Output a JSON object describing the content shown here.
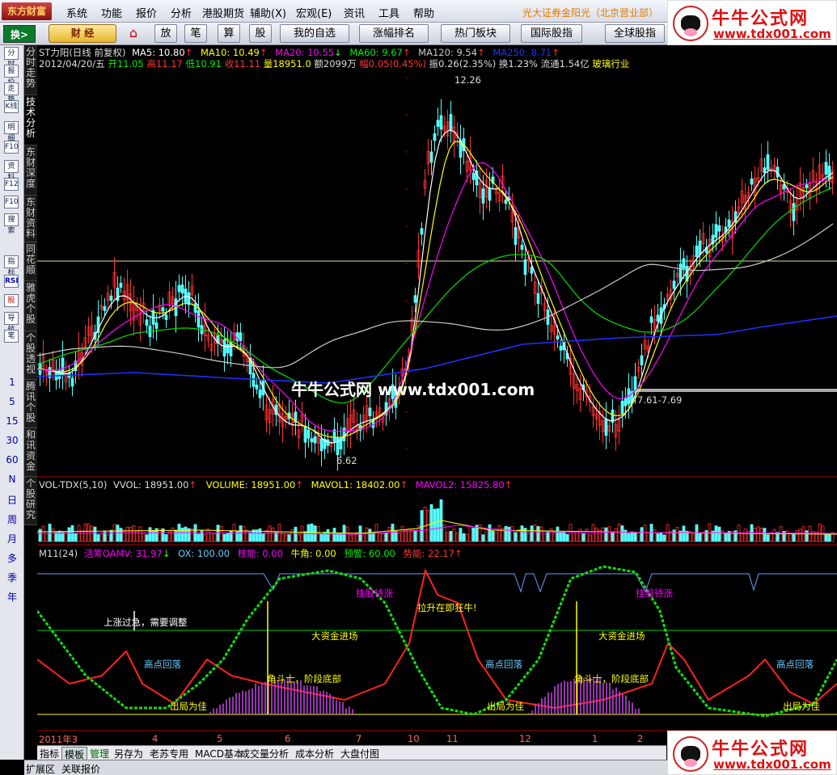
{
  "menubar": {
    "logo": "东方财富",
    "items": [
      "系统",
      "功能",
      "报价",
      "分析",
      "港股期货",
      "辅助(X)",
      "宏观(E)",
      "资讯",
      "工具",
      "帮助"
    ],
    "broker": "光大证券金阳光（北京营业部）"
  },
  "watermark": {
    "name": "牛牛公式网",
    "url": "www.tdx001.com",
    "center": "牛牛公式网  www.tdx001.com"
  },
  "toolbar": {
    "switch": "换>",
    "caijing": "财 经",
    "home_icon": "home-icon",
    "buttons": [
      "放",
      "笔",
      "算",
      "股",
      "我的自选",
      "涨幅排名",
      "热门板块",
      "国际股指",
      "全球股指"
    ]
  },
  "left_icons": {
    "items": [
      "分时",
      "报价",
      "走势",
      "K线",
      "明细",
      "F10",
      "资料",
      "F12",
      "F10",
      "搜索",
      "指标",
      "RSI",
      "股",
      "导航",
      "笔"
    ],
    "periods": [
      "1",
      "5",
      "15",
      "30",
      "60",
      "N",
      "日",
      "周",
      "月",
      "多",
      "季",
      "年"
    ]
  },
  "side_tabs": [
    "分时走势",
    "技术分析",
    "东财深度",
    "东财资料",
    "同花顺",
    "雅虎个股",
    "个股透视",
    "腾讯个股",
    "和讯资金",
    "个股研究"
  ],
  "main_panel": {
    "title": "ST力阳(日线 前复权)",
    "ma5": "MA5: 10.80",
    "ma10": "MA10: 10.49",
    "ma20": "MA20: 10.55",
    "ma60": "MA60: 9.67",
    "ma120": "MA120: 9.54",
    "ma250": "MA250: 8.71",
    "quote": {
      "date": "2012/04/20/五",
      "open": "开11.05",
      "high": "高11.17",
      "low": "低10.91",
      "close": "收11.11",
      "vol": "量18951.0",
      "amount": "额2099万",
      "change": "幅0.05(0.45%)",
      "amp": "振0.26(2.35%)",
      "turnover": "换1.23%",
      "float": "流通1.54亿",
      "industry": "玻璃行业"
    },
    "high_label": "12.26",
    "low_label": "6.62",
    "range_label": "7.61-7.69"
  },
  "vol_panel": {
    "title": "VOL-TDX(5,10)",
    "vvol": "VVOL: 18951.00",
    "volume": "VOLUME: 18951.00",
    "mavol1": "MAVOL1: 18402.00",
    "mavol2": "MAVOL2: 15825.80"
  },
  "ind_panel": {
    "title": "M11(24)",
    "oamv": "活筹OAMV: 31.97",
    "ox": "OX: 100.00",
    "core": "核能: 0.00",
    "bull": "牛角: 0.00",
    "warn": "预警: 60.00",
    "power": "势能: 22.17",
    "annotations": [
      "上涨过急，需要调整",
      "高点回落",
      "出局为佳",
      "角斗士，阶段底部",
      "大资金进场",
      "挂股待涨",
      "拉升在即狂牛!",
      "高点回落",
      "出局为佳",
      "大资金进场",
      "角斗士，阶段底部",
      "挂股待涨",
      "高点回落",
      "出局为佳"
    ]
  },
  "xaxis": {
    "labels": [
      "2011年3",
      "4",
      "5",
      "6",
      "7",
      "10",
      "11",
      "12",
      "1",
      "2"
    ]
  },
  "bottom_tabs": [
    "指标",
    "模板",
    "管理",
    "另存为",
    "老苏专用",
    "MACD基本",
    "成交量分析",
    "成本分析",
    "大盘付图"
  ],
  "status": {
    "left": "扩展区",
    "right": "关联报价"
  },
  "colors": {
    "up": "#ff3232",
    "down": "#54fcfc",
    "ma5": "#ffffff",
    "ma10": "#ffff00",
    "ma20": "#ff00ff",
    "ma60": "#00e000",
    "ma120": "#cccccc",
    "ma250": "#2030ff"
  }
}
